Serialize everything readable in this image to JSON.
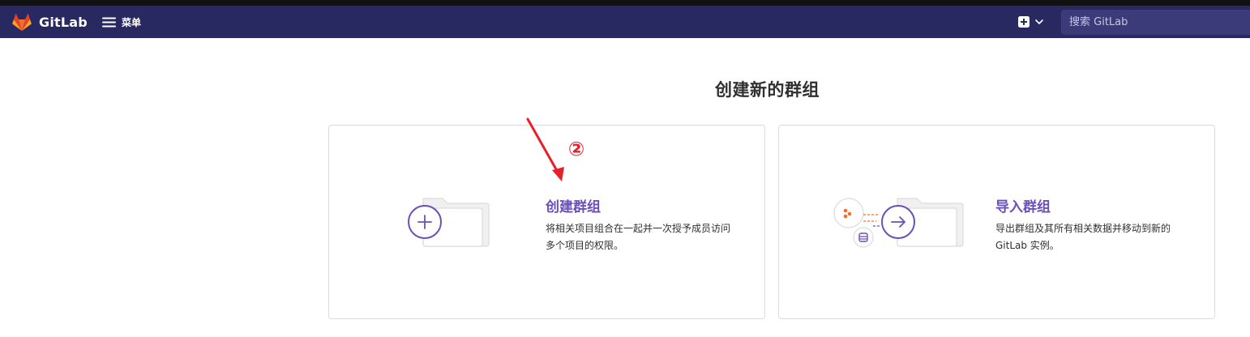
{
  "header": {
    "brand_name": "GitLab",
    "menu_label": "菜单",
    "search_placeholder": "搜索 GitLab",
    "brand_color": "#292961",
    "logo_colors": [
      "#e24329",
      "#fc6d26",
      "#fca326"
    ]
  },
  "main": {
    "page_title": "创建新的群组",
    "cards": [
      {
        "title": "创建群组",
        "description": "将相关项目组合在一起并一次授予成员访问多个项目的权限。",
        "icon": "folder-plus-icon"
      },
      {
        "title": "导入群组",
        "description": "导出群组及其所有相关数据并移动到新的 GitLab 实例。",
        "icon": "folder-import-icon"
      }
    ]
  },
  "annotation": {
    "marker": "②",
    "color": "#e8202a"
  },
  "colors": {
    "accent": "#6b4fbb",
    "text": "#303030",
    "border": "#dcdcde"
  }
}
